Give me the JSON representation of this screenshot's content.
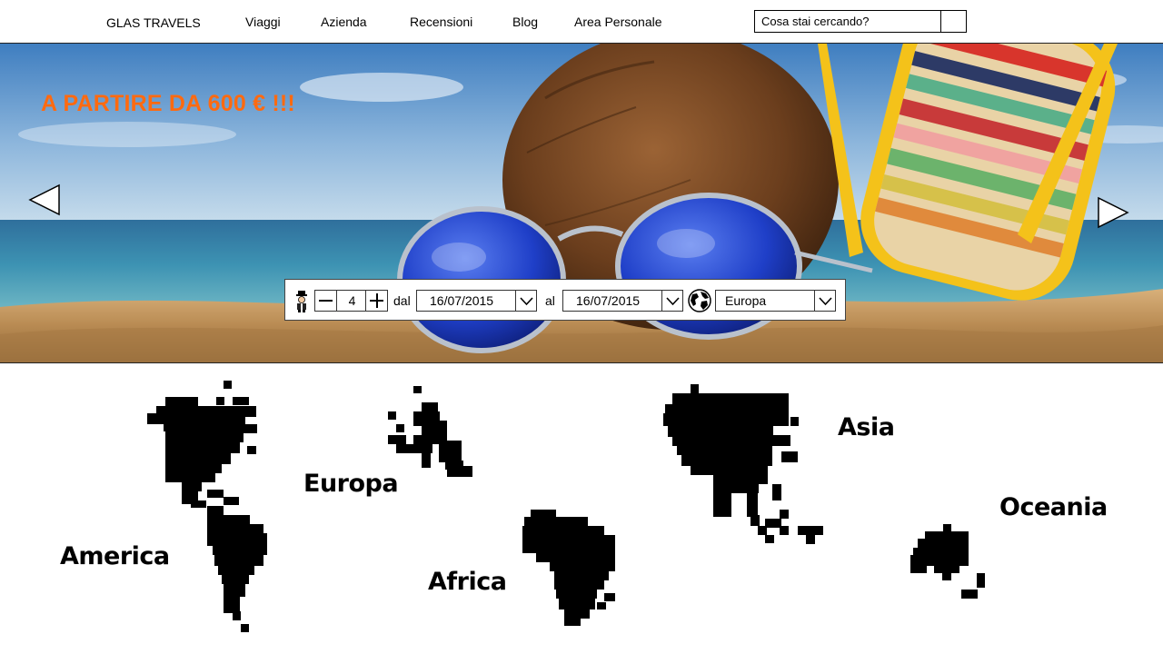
{
  "nav": {
    "brand": "GLAS TRAVELS",
    "links": [
      "Viaggi",
      "Azienda",
      "Recensioni",
      "Blog",
      "Area Personale"
    ],
    "search_placeholder": "Cosa stai cercando?"
  },
  "hero": {
    "promo": "A PARTIRE DA 600 € !!!",
    "promo_color": "#ff6a10"
  },
  "booking": {
    "travelers_icon": "person-icon",
    "travelers": "4",
    "from_label": "dal",
    "from_date": "16/07/2015",
    "to_label": "al",
    "to_date": "16/07/2015",
    "destination_icon": "globe-icon",
    "destination": "Europa"
  },
  "map": {
    "continents": [
      "America",
      "Europa",
      "Africa",
      "Asia",
      "Oceania"
    ]
  }
}
